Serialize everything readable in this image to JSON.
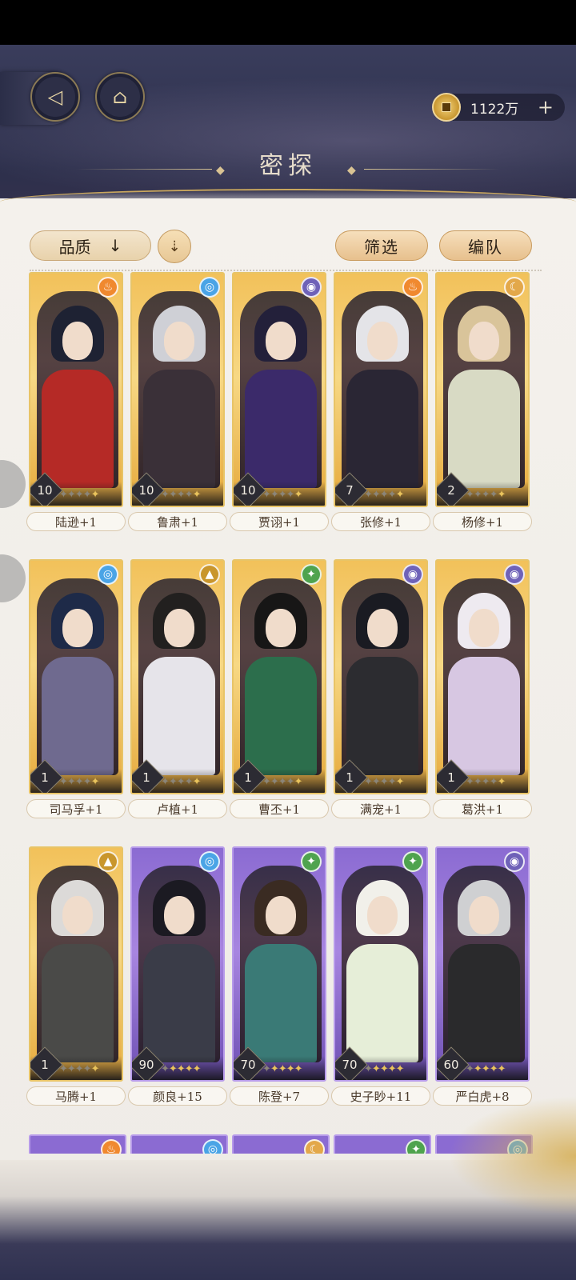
{
  "header": {
    "back_icon": "back-arrow-icon",
    "home_icon": "pavilion-icon",
    "currency_value": "1122万",
    "currency_plus": "+",
    "title": "密探"
  },
  "toolbar": {
    "sort_label": "品质",
    "sort_arrow": "↓",
    "order_icon": "⇣",
    "filter_label": "筛选",
    "team_label": "编队"
  },
  "colors": {
    "fire": "#f0892f",
    "water": "#4aa4e6",
    "shadow": "#6f62b8",
    "earth": "#c9962c",
    "wind": "#4fa34e",
    "moon": "#e3a84a"
  },
  "cards": [
    {
      "name": "陆逊+1",
      "level": "10",
      "element": "fire",
      "rarity": "gold",
      "stars_filled": 1
    },
    {
      "name": "鲁肃+1",
      "level": "10",
      "element": "water",
      "rarity": "gold",
      "stars_filled": 1
    },
    {
      "name": "贾诩+1",
      "level": "10",
      "element": "shadow",
      "rarity": "gold",
      "stars_filled": 1
    },
    {
      "name": "张修+1",
      "level": "7",
      "element": "fire",
      "rarity": "gold",
      "stars_filled": 1
    },
    {
      "name": "杨修+1",
      "level": "2",
      "element": "moon",
      "rarity": "gold",
      "stars_filled": 1
    },
    {
      "name": "司马孚+1",
      "level": "1",
      "element": "water",
      "rarity": "gold",
      "stars_filled": 1
    },
    {
      "name": "卢植+1",
      "level": "1",
      "element": "earth",
      "rarity": "gold",
      "stars_filled": 1
    },
    {
      "name": "曹丕+1",
      "level": "1",
      "element": "wind",
      "rarity": "gold",
      "stars_filled": 1
    },
    {
      "name": "满宠+1",
      "level": "1",
      "element": "shadow",
      "rarity": "gold",
      "stars_filled": 1
    },
    {
      "name": "葛洪+1",
      "level": "1",
      "element": "shadow",
      "rarity": "gold",
      "stars_filled": 1
    },
    {
      "name": "马腾+1",
      "level": "1",
      "element": "earth",
      "rarity": "gold",
      "stars_filled": 1
    },
    {
      "name": "颜良+15",
      "level": "90",
      "element": "water",
      "rarity": "purple",
      "stars_filled": 4
    },
    {
      "name": "陈登+7",
      "level": "70",
      "element": "wind",
      "rarity": "purple",
      "stars_filled": 4
    },
    {
      "name": "史子眇+11",
      "level": "70",
      "element": "wind",
      "rarity": "purple",
      "stars_filled": 4
    },
    {
      "name": "严白虎+8",
      "level": "60",
      "element": "shadow",
      "rarity": "purple",
      "stars_filled": 4
    }
  ],
  "partial_row": [
    {
      "element": "fire",
      "rarity": "purple"
    },
    {
      "element": "water",
      "rarity": "purple"
    },
    {
      "element": "moon",
      "rarity": "purple"
    },
    {
      "element": "wind",
      "rarity": "purple"
    },
    {
      "element": "water",
      "rarity": "purple"
    }
  ]
}
